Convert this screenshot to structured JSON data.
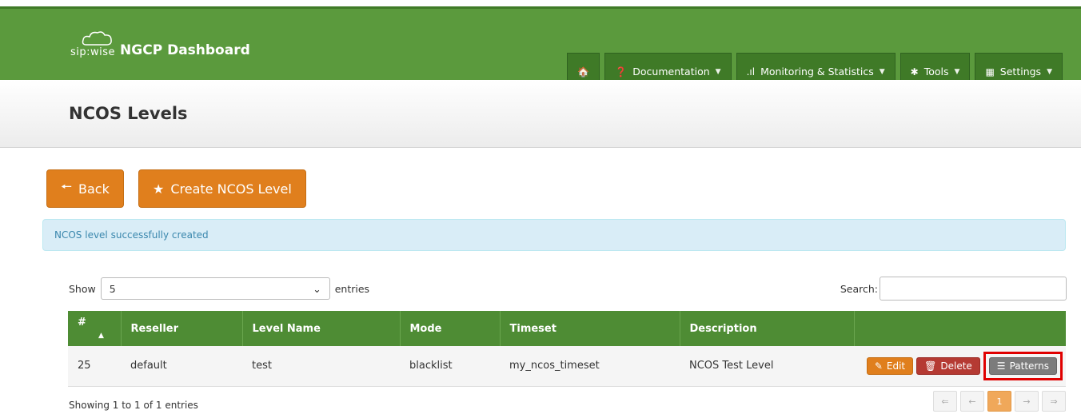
{
  "brand": {
    "small": "sip:wise",
    "title": "NGCP Dashboard"
  },
  "nav": [
    {
      "icon": "home-icon",
      "glyph": "🏠",
      "label": ""
    },
    {
      "icon": "question-icon",
      "glyph": "❓",
      "label": "Documentation"
    },
    {
      "icon": "signal-icon",
      "glyph": ".ıl",
      "label": "Monitoring & Statistics"
    },
    {
      "icon": "gear-icon",
      "glyph": "✱",
      "label": "Tools"
    },
    {
      "icon": "grid-icon",
      "glyph": "▦",
      "label": "Settings"
    }
  ],
  "page": {
    "title": "NCOS Levels"
  },
  "actions": {
    "back_label": "Back",
    "create_label": "Create NCOS Level"
  },
  "alert": {
    "message": "NCOS level successfully created"
  },
  "table_controls": {
    "show_label": "Show",
    "entries_value": "5",
    "entries_label": "entries",
    "search_label": "Search:"
  },
  "table": {
    "columns": [
      "#",
      "Reseller",
      "Level Name",
      "Mode",
      "Timeset",
      "Description",
      ""
    ],
    "rows": [
      {
        "id": "25",
        "reseller": "default",
        "level_name": "test",
        "mode": "blacklist",
        "timeset": "my_ncos_timeset",
        "description": "NCOS Test Level"
      }
    ],
    "row_actions": {
      "edit": "Edit",
      "delete": "Delete",
      "patterns": "Patterns"
    }
  },
  "footer": {
    "info": "Showing 1 to 1 of 1 entries",
    "pages": [
      "⇐",
      "←",
      "1",
      "→",
      "⇒"
    ],
    "current_page": "1"
  },
  "colors": {
    "brand_green": "#5b9a3d",
    "accent_orange": "#e07f1d",
    "delete_red": "#b53a33",
    "highlight_red": "#e00000"
  }
}
